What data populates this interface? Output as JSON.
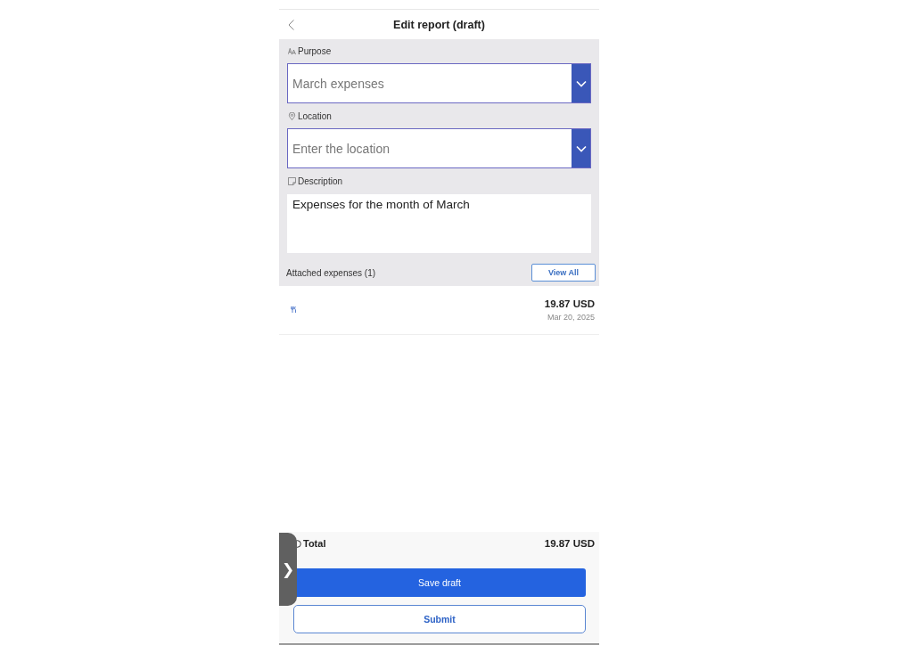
{
  "header": {
    "title": "Edit report (draft)"
  },
  "form": {
    "fields": [
      {
        "kind": "dropdown",
        "label": "Purpose",
        "value": "March expenses"
      },
      {
        "kind": "dropdown",
        "label": "Location",
        "placeholder": "Enter the location"
      },
      {
        "kind": "textarea",
        "label": "Description",
        "value": "Expenses for the month of March"
      }
    ],
    "attached": {
      "label": "Attached expenses (1)",
      "button": "View All"
    }
  },
  "expenses": [
    {
      "amount": "19.87 USD",
      "date": "Mar 20, 2025"
    }
  ],
  "footer": {
    "total_label": "Total",
    "total_value": "19.87 USD",
    "buttons": [
      {
        "kind": "primary",
        "label": "Save draft"
      },
      {
        "kind": "secondary",
        "label": "Submit"
      }
    ]
  },
  "side_tab": {
    "glyph": "❯"
  }
}
